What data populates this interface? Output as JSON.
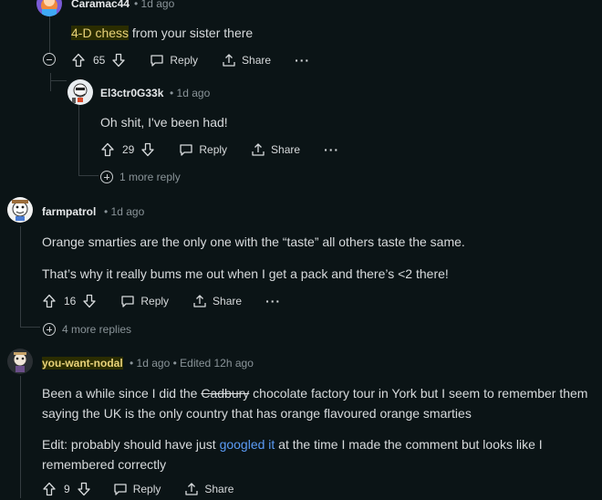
{
  "comments": [
    {
      "username": "Caramac44",
      "time": "1d ago",
      "body_highlight": "4-D chess",
      "body_rest": " from your sister there",
      "votes": "65",
      "reply_label": "Reply",
      "share_label": "Share",
      "more_label": "···"
    },
    {
      "username": "El3ctr0G33k",
      "time": "1d ago",
      "body": "Oh shit, I've been had!",
      "votes": "29",
      "reply_label": "Reply",
      "share_label": "Share",
      "more_label": "···",
      "more_replies": "1 more reply"
    },
    {
      "username": "farmpatrol",
      "time": "1d ago",
      "body_lines": [
        "Orange smarties are the only one with the “taste” all others taste the same.",
        "That’s why it really bums me out when I get a pack and there’s <2 there!"
      ],
      "votes": "16",
      "reply_label": "Reply",
      "share_label": "Share",
      "more_label": "···",
      "more_replies": "4 more replies"
    },
    {
      "username": "you-want-nodal",
      "time": "1d ago",
      "edited": "Edited 12h ago",
      "p1_a": "Been a while since I did the ",
      "p1_strike": "Cadbury",
      "p1_b": " chocolate factory tour in York but I seem to remember them",
      "p1_line2": "saying the UK is the only country that has orange flavoured orange smarties",
      "p2_a": "Edit: probably should have just ",
      "p2_link": "googled it",
      "p2_b": " at the time I made the comment but looks like I",
      "p2_line2": "remembered correctly",
      "votes": "9",
      "reply_label": "Reply",
      "share_label": "Share"
    }
  ],
  "dot": "•",
  "colors": {
    "bg": "#0b1416",
    "highlight": "#e8d27a",
    "link": "#5b9bf4",
    "thread_line": "#343c40"
  }
}
